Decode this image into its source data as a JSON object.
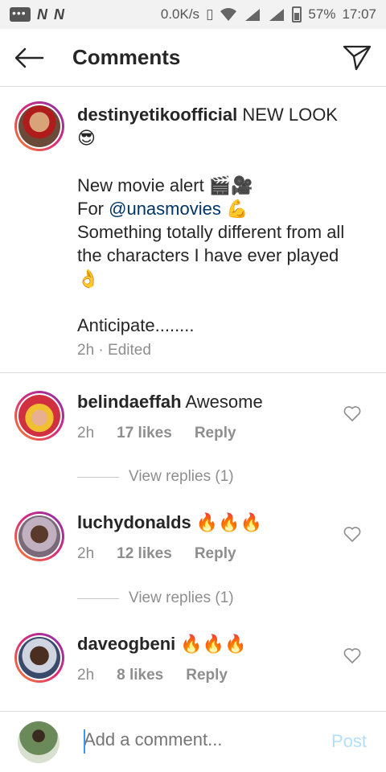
{
  "status_bar": {
    "speed": "0.0K/s",
    "battery": "57%",
    "time": "17:07"
  },
  "header": {
    "title": "Comments"
  },
  "post": {
    "username": "destinyetikoofficial",
    "caption_lines": [
      "NEW LOOK",
      "😎",
      "",
      "New movie alert 🎬🎥",
      "For ",
      "@unasmovies",
      " 💪",
      "Something totally different from all the characters I have ever played 👌",
      "",
      "Anticipate........"
    ],
    "time": "2h",
    "edited": "Edited",
    "separator": " · "
  },
  "comments": [
    {
      "username": "belindaeffah",
      "text": "Awesome",
      "time": "2h",
      "likes": "17 likes",
      "reply": "Reply",
      "view_replies": "View replies (1)"
    },
    {
      "username": "luchydonalds",
      "text": "🔥🔥🔥",
      "time": "2h",
      "likes": "12 likes",
      "reply": "Reply",
      "view_replies": "View replies (1)"
    },
    {
      "username": "daveogbeni",
      "text": "🔥🔥🔥",
      "time": "2h",
      "likes": "8 likes",
      "reply": "Reply"
    }
  ],
  "input": {
    "placeholder": "Add a comment...",
    "post_label": "Post"
  },
  "colors": {
    "accent": "#3897f0",
    "post_disabled": "#b2dffc",
    "mention": "#003569",
    "muted": "#8e8e8e"
  }
}
